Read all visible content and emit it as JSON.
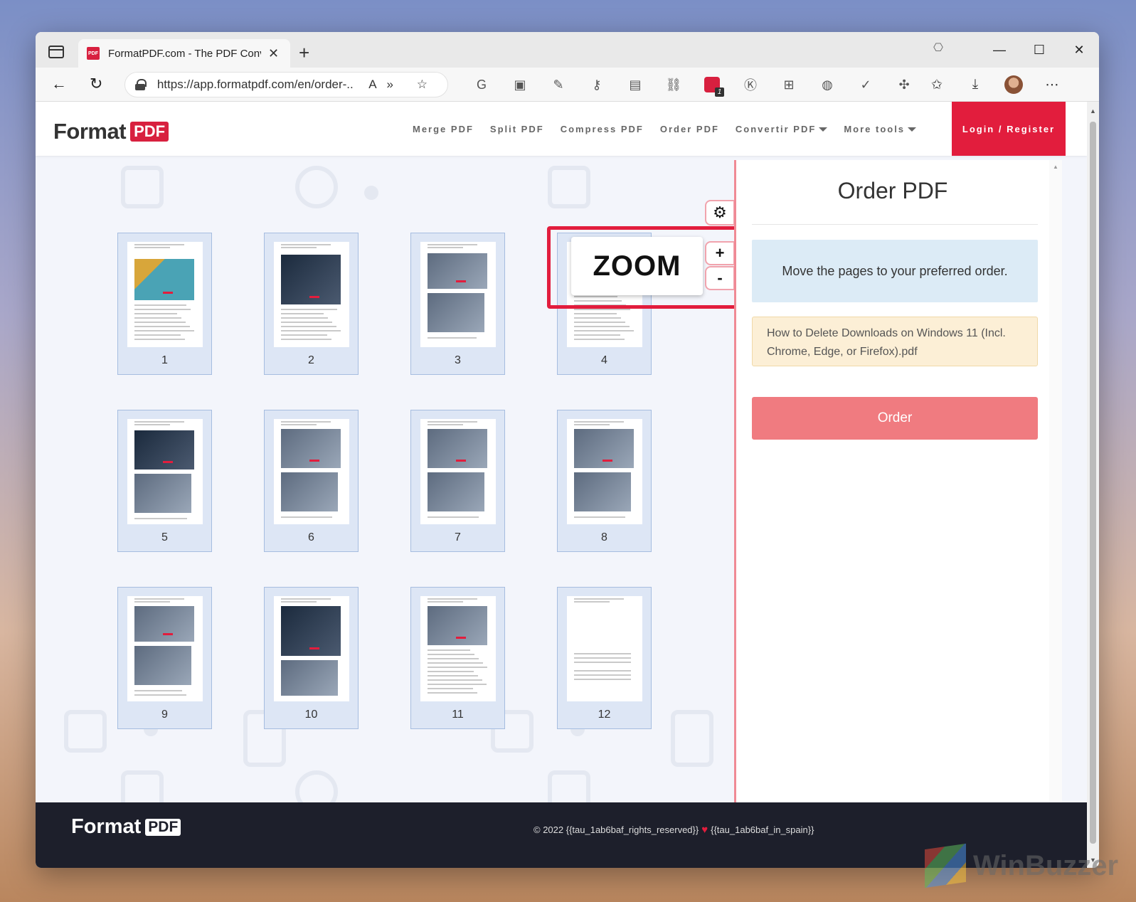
{
  "browser": {
    "tab_title": "FormatPDF.com - The PDF Conve",
    "favicon_text": "PDF",
    "url": "https://app.formatpdf.com/en/order-...",
    "read_aloud_icon": "A»"
  },
  "site": {
    "logo_word": "Format",
    "logo_pdf": "PDF",
    "nav": {
      "merge": "Merge PDF",
      "split": "Split PDF",
      "compress": "Compress PDF",
      "order": "Order PDF",
      "convert": "Convertir PDF",
      "more": "More tools"
    },
    "login": "Login / Register"
  },
  "pages": [
    {
      "num": "1"
    },
    {
      "num": "2"
    },
    {
      "num": "3"
    },
    {
      "num": "4"
    },
    {
      "num": "5"
    },
    {
      "num": "6"
    },
    {
      "num": "7"
    },
    {
      "num": "8"
    },
    {
      "num": "9"
    },
    {
      "num": "10"
    },
    {
      "num": "11"
    },
    {
      "num": "12"
    }
  ],
  "zoom": {
    "label": "ZOOM",
    "plus": "+",
    "minus": "-",
    "highlight_color": "#e21d3d"
  },
  "panel": {
    "title": "Order PDF",
    "info": "Move the pages to your preferred order.",
    "filename": "How to Delete Downloads on Windows 11 (Incl. Chrome, Edge, or Firefox).pdf",
    "order_button": "Order"
  },
  "footer": {
    "logo_word": "Format",
    "logo_pdf": "PDF",
    "copyright_left": "© 2022 {{tau_1ab6baf_rights_reserved}}",
    "heart": "♥",
    "copyright_right": "{{tau_1ab6baf_in_spain}}"
  },
  "watermark": "WinBuzzer",
  "colors": {
    "brand_red": "#e21d3d",
    "order_button": "#f07b80",
    "info_bg": "#dcebf6",
    "file_bg": "#fcefd6"
  }
}
